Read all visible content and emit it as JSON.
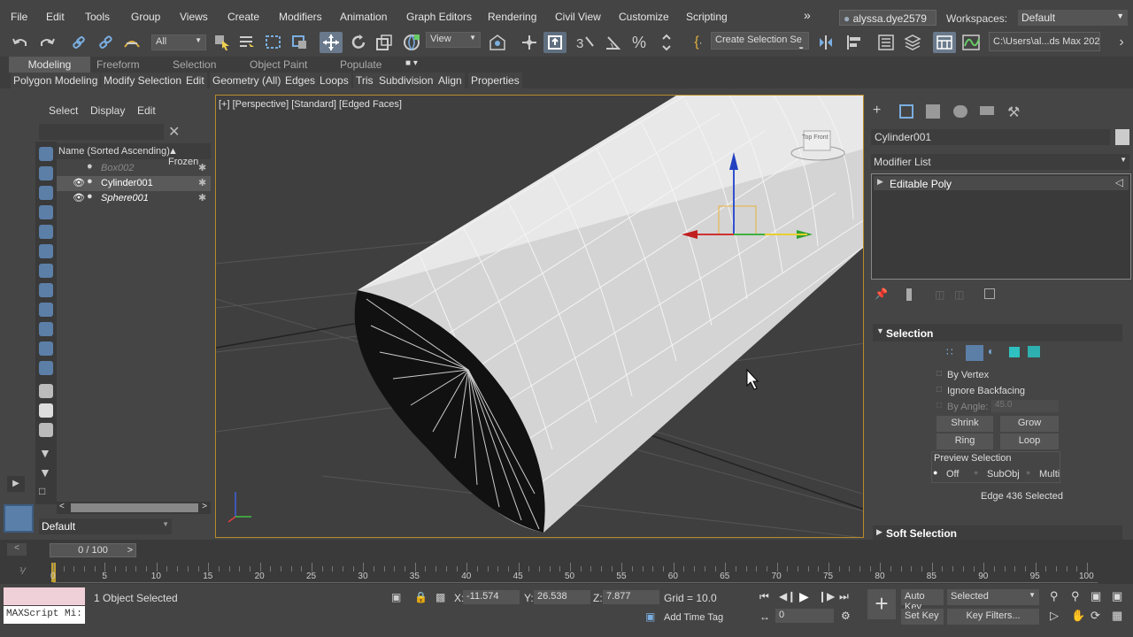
{
  "menubar": {
    "items": [
      "File",
      "Edit",
      "Tools",
      "Group",
      "Views",
      "Create",
      "Modifiers",
      "Animation",
      "Graph Editors",
      "Rendering",
      "Civil View",
      "Customize",
      "Scripting"
    ],
    "more": "»",
    "account": "alyssa.dye2579",
    "workspaces_label": "Workspaces:",
    "workspace": "Default"
  },
  "toolbar": {
    "selection_filter": "All",
    "ref_coord": "View",
    "named_selection": "Create Selection Se",
    "path": "C:\\Users\\al...ds Max 2021"
  },
  "ribbon": {
    "tabs": [
      "Modeling",
      "Freeform",
      "Selection",
      "Object Paint",
      "Populate"
    ],
    "commands": [
      "Polygon Modeling",
      "Modify Selection",
      "Edit",
      "Geometry (All)",
      "Edges",
      "Loops",
      "Tris",
      "Subdivision",
      "Align",
      "Properties"
    ]
  },
  "explorer": {
    "menu": [
      "Select",
      "Display",
      "Edit"
    ],
    "column_name": "Name (Sorted Ascending)",
    "column_frozen": "▲ Frozen",
    "objects": [
      {
        "name": "Box002",
        "hidden": true,
        "selected": false
      },
      {
        "name": "Cylinder001",
        "hidden": false,
        "selected": true
      },
      {
        "name": "Sphere001",
        "hidden": false,
        "selected": false
      }
    ],
    "layer": "Default"
  },
  "viewport": {
    "label": "[+] [Perspective] [Standard] [Edged Faces]",
    "viewcube_text": "Top Front"
  },
  "command_panel": {
    "object_name": "Cylinder001",
    "modifier_list": "Modifier List",
    "stack_item": "Editable Poly",
    "rollout_selection": "Selection",
    "by_vertex": "By Vertex",
    "ignore_backfacing": "Ignore Backfacing",
    "by_angle_label": "By Angle:",
    "by_angle_value": "45.0",
    "shrink": "Shrink",
    "grow": "Grow",
    "ring": "Ring",
    "loop": "Loop",
    "preview_selection": "Preview Selection",
    "preview_off": "Off",
    "preview_subobj": "SubObj",
    "preview_multi": "Multi",
    "selection_status": "Edge 436 Selected",
    "rollout_soft": "Soft Selection"
  },
  "timeline": {
    "frame": "0 / 100",
    "ticks": [
      "0",
      "5",
      "10",
      "15",
      "20",
      "25",
      "30",
      "35",
      "40",
      "45",
      "50",
      "55",
      "60",
      "65",
      "70",
      "75",
      "80",
      "85",
      "90",
      "95",
      "100"
    ]
  },
  "status": {
    "maxscript": "MAXScript Mi:",
    "selected": "1 Object Selected",
    "x_label": "X:",
    "x": "-11.574",
    "y_label": "Y:",
    "y": "26.538",
    "z_label": "Z:",
    "z": "7.877",
    "grid": "Grid = 10.0",
    "add_time_tag": "Add Time Tag",
    "auto_key": "Auto Key",
    "set_key": "Set Key",
    "key_mode": "Selected",
    "key_filters": "Key Filters...",
    "current_frame": "0"
  },
  "colors": {
    "accent": "#5c7fa8",
    "viewport_border": "#b88a2a"
  }
}
